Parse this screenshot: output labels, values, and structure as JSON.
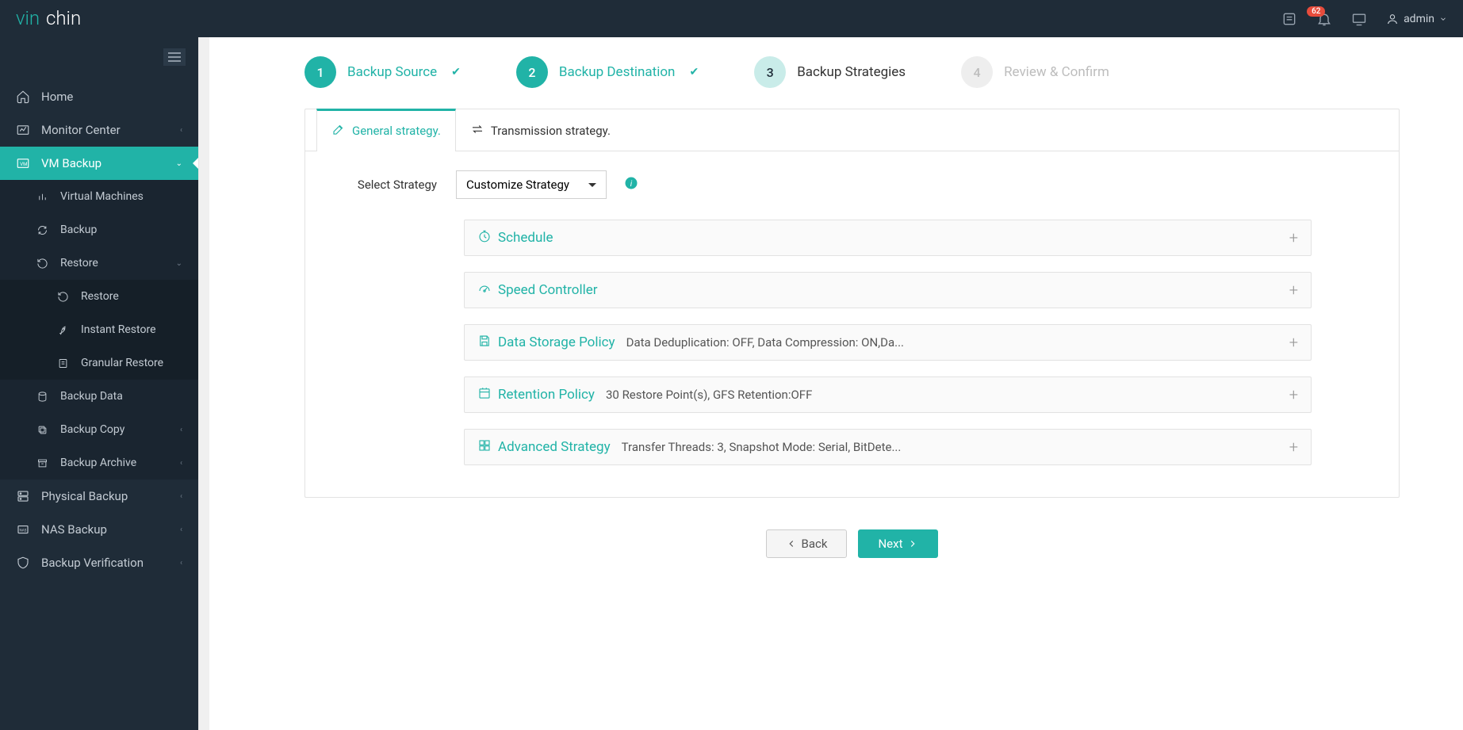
{
  "brand": {
    "part1": "vin",
    "part2": "chin"
  },
  "topbar": {
    "notification_count": "62",
    "username": "admin"
  },
  "sidebar": {
    "home": "Home",
    "monitor": "Monitor Center",
    "vm_backup": "VM Backup",
    "vm_sub": {
      "virtual_machines": "Virtual Machines",
      "backup": "Backup",
      "restore": "Restore",
      "restore_sub": {
        "restore": "Restore",
        "instant_restore": "Instant Restore",
        "granular_restore": "Granular Restore"
      },
      "backup_data": "Backup Data",
      "backup_copy": "Backup Copy",
      "backup_archive": "Backup Archive"
    },
    "physical_backup": "Physical Backup",
    "nas_backup": "NAS Backup",
    "backup_verification": "Backup Verification"
  },
  "steps": {
    "s1": {
      "num": "1",
      "label": "Backup Source"
    },
    "s2": {
      "num": "2",
      "label": "Backup Destination"
    },
    "s3": {
      "num": "3",
      "label": "Backup Strategies"
    },
    "s4": {
      "num": "4",
      "label": "Review & Confirm"
    }
  },
  "tabs": {
    "general": "General strategy.",
    "transmission": "Transmission strategy."
  },
  "form": {
    "select_strategy_label": "Select Strategy",
    "select_strategy_value": "Customize Strategy"
  },
  "accordions": {
    "schedule": {
      "title": "Schedule",
      "summary": ""
    },
    "speed": {
      "title": "Speed Controller",
      "summary": ""
    },
    "storage": {
      "title": "Data Storage Policy",
      "summary": "Data Deduplication: OFF, Data Compression: ON,Da..."
    },
    "retention": {
      "title": "Retention Policy",
      "summary": "30 Restore Point(s), GFS Retention:OFF"
    },
    "advanced": {
      "title": "Advanced Strategy",
      "summary": "Transfer Threads: 3, Snapshot Mode: Serial, BitDete..."
    }
  },
  "buttons": {
    "back": "Back",
    "next": "Next"
  }
}
